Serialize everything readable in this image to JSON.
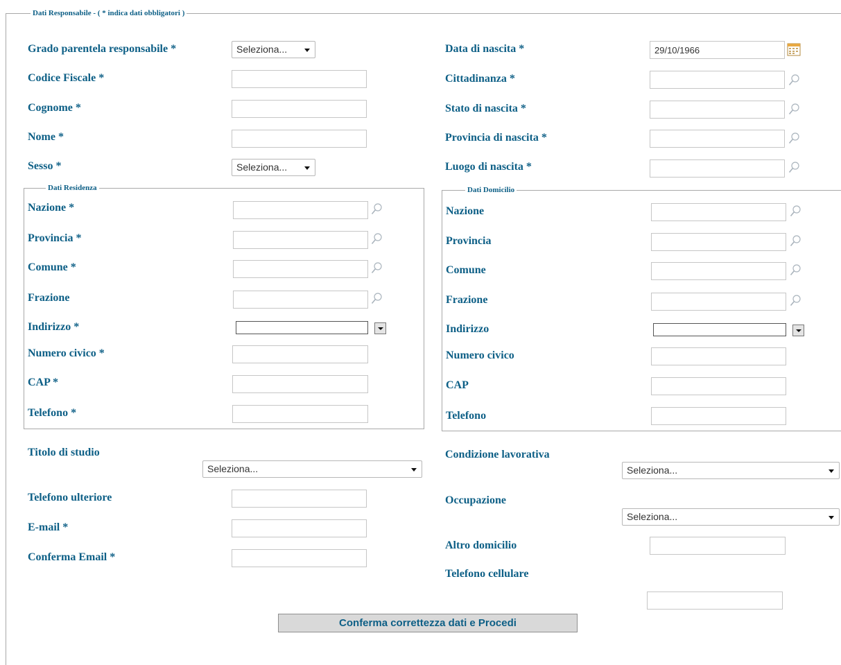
{
  "main_legend": "Dati Responsabile - ( * indica dati obbligatori )",
  "left": {
    "grado_label": "Grado parentela responsabile *",
    "grado_value": "Seleziona...",
    "cf_label": "Codice Fiscale *",
    "cognome_label": "Cognome *",
    "nome_label": "Nome *",
    "sesso_label": "Sesso *",
    "sesso_value": "Seleziona..."
  },
  "right": {
    "data_nascita_label": "Data di nascita *",
    "data_nascita_value": "29/10/1966",
    "cittadinanza_label": "Cittadinanza *",
    "stato_nascita_label": "Stato di nascita *",
    "provincia_nascita_label": "Provincia di nascita *",
    "luogo_nascita_label": "Luogo di nascita *"
  },
  "residenza": {
    "legend": "Dati Residenza",
    "nazione_label": "Nazione *",
    "provincia_label": "Provincia *",
    "comune_label": "Comune *",
    "frazione_label": "Frazione",
    "indirizzo_label": "Indirizzo *",
    "civico_label": "Numero civico *",
    "cap_label": "CAP *",
    "telefono_label": "Telefono *"
  },
  "domicilio": {
    "legend": "Dati Domicilio",
    "nazione_label": "Nazione",
    "provincia_label": "Provincia",
    "comune_label": "Comune",
    "frazione_label": "Frazione",
    "indirizzo_label": "Indirizzo",
    "civico_label": "Numero civico",
    "cap_label": "CAP",
    "telefono_label": "Telefono"
  },
  "bottom_left": {
    "titolo_label": "Titolo di studio",
    "titolo_value": "Seleziona...",
    "tel_ulteriore_label": "Telefono ulteriore",
    "email_label": "E-mail *",
    "conferma_email_label": "Conferma Email *"
  },
  "bottom_right": {
    "condizione_label": "Condizione lavorativa",
    "condizione_value": "Seleziona...",
    "occupazione_label": "Occupazione",
    "occupazione_value": "Seleziona...",
    "altro_domicilio_label": "Altro domicilio",
    "cellulare_label": "Telefono cellulare"
  },
  "submit_label": "Conferma correttezza dati e Procedi",
  "colors": {
    "label": "#0d5f86",
    "border": "#c6c6c6",
    "button_bg": "#d9d9d9"
  },
  "icons": {
    "lookup": "magnifier-icon",
    "date": "calendar-icon",
    "dropdown": "chevron-down-icon"
  }
}
